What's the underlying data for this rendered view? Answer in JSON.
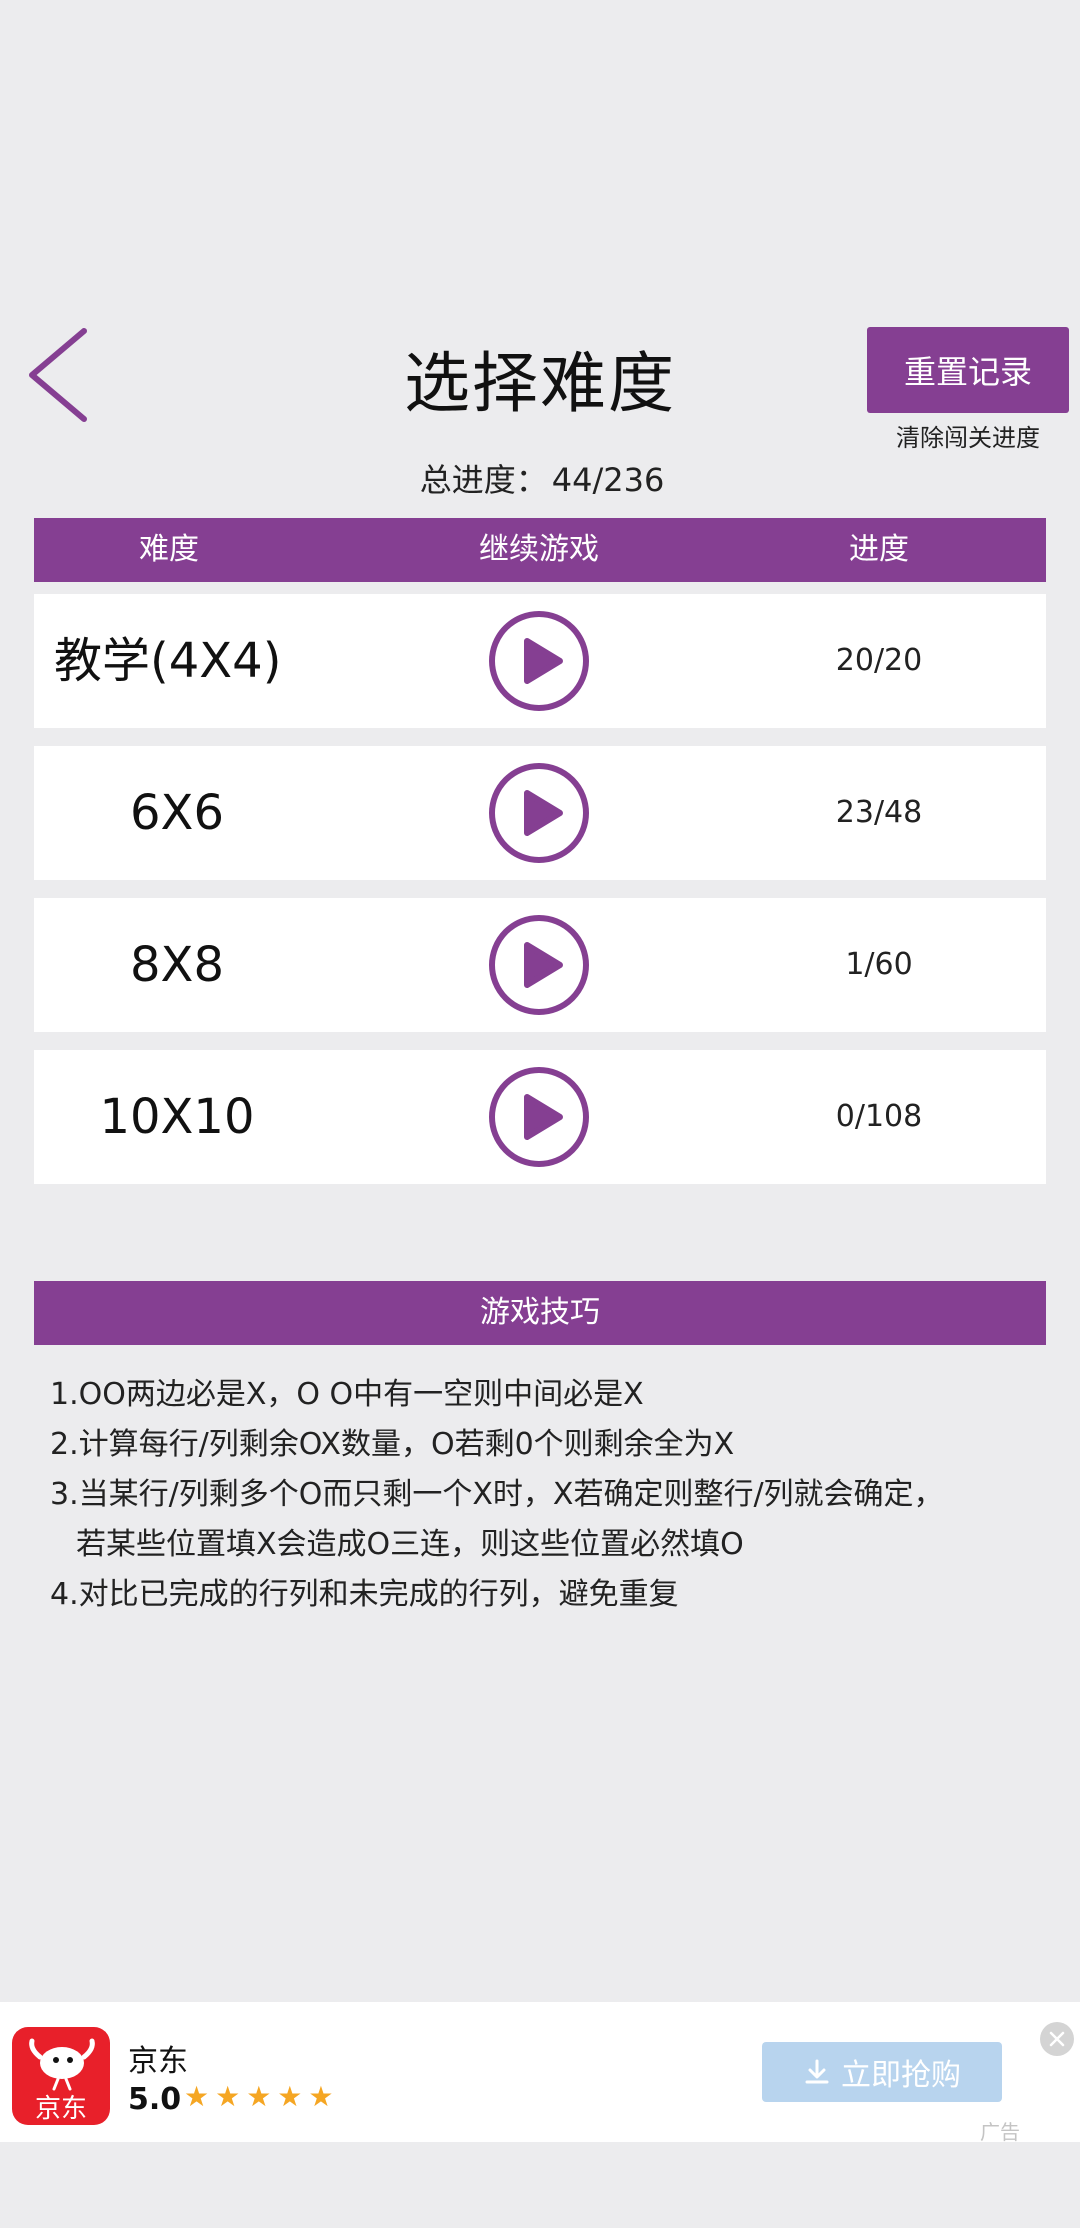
{
  "header": {
    "title": "选择难度",
    "reset_label": "重置记录",
    "reset_hint": "清除闯关进度",
    "total_progress_label": "总进度：",
    "total_progress_value": "44/236"
  },
  "table": {
    "columns": [
      "难度",
      "继续游戏",
      "进度"
    ],
    "rows": [
      {
        "level": "教学(4X4)",
        "progress": "20/20"
      },
      {
        "level": "6X6",
        "progress": "23/48"
      },
      {
        "level": "8X8",
        "progress": "1/60"
      },
      {
        "level": "10X10",
        "progress": "0/108"
      }
    ]
  },
  "tips": {
    "title": "游戏技巧",
    "lines": [
      "1.OO两边必是X，O O中有一空则中间必是X",
      "2.计算每行/列剩余OX数量，O若剩0个则剩余全为X",
      "3.当某行/列剩多个O而只剩一个X时，X若确定则整行/列就会确定，",
      "若某些位置填X会造成O三连，则这些位置必然填O",
      "4.对比已完成的行列和未完成的行列，避免重复"
    ]
  },
  "ad": {
    "logo_text": "京东",
    "name": "京东",
    "rating": "5.0",
    "stars": "★★★★★",
    "cta_label": "立即抢购",
    "tag": "广告"
  },
  "colors": {
    "accent": "#853f92",
    "background": "#ececee",
    "ad_button": "#b8d4ee",
    "star": "#f5a623"
  },
  "icons": {
    "back": "chevron-left-icon",
    "play": "play-circle-icon",
    "download": "download-icon",
    "close": "close-icon"
  }
}
